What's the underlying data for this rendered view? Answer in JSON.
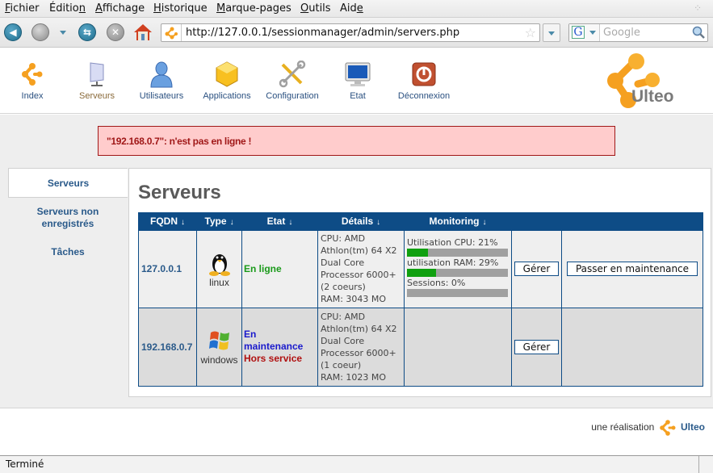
{
  "browser": {
    "menu": [
      {
        "label": "Fichier",
        "ul": 0
      },
      {
        "label": "Édition",
        "ul": 6
      },
      {
        "label": "Affichage",
        "ul": 0
      },
      {
        "label": "Historique",
        "ul": 0
      },
      {
        "label": "Marque-pages",
        "ul": 0
      },
      {
        "label": "Outils",
        "ul": 0
      },
      {
        "label": "Aide",
        "ul": 3
      }
    ],
    "url": "http://127.0.0.1/sessionmanager/admin/servers.php",
    "search_placeholder": "Google",
    "search_engine_letter": "G",
    "status": "Terminé"
  },
  "topnav": {
    "items": [
      {
        "label": "Index",
        "icon": "ulteo-logo-icon"
      },
      {
        "label": "Serveurs",
        "icon": "server-icon",
        "active": true
      },
      {
        "label": "Utilisateurs",
        "icon": "user-icon"
      },
      {
        "label": "Applications",
        "icon": "applications-icon"
      },
      {
        "label": "Configuration",
        "icon": "tools-icon"
      },
      {
        "label": "Etat",
        "icon": "monitor-icon"
      },
      {
        "label": "Déconnexion",
        "icon": "power-icon"
      }
    ],
    "logo_text": "Ulteo"
  },
  "alert": "\"192.168.0.7\": n'est pas en ligne !",
  "sidebar": {
    "items": [
      {
        "label": "Serveurs",
        "active": true
      },
      {
        "label": "Serveurs non enregistrés"
      },
      {
        "label": "Tâches"
      }
    ]
  },
  "main": {
    "title": "Serveurs",
    "columns": [
      "FQDN",
      "Type",
      "Etat",
      "Détails",
      "Monitoring"
    ],
    "sort_arrow": "↓",
    "rows": [
      {
        "fqdn": "127.0.0.1",
        "type": "linux",
        "states": [
          {
            "text": "En ligne",
            "color": "#1a9a1a"
          }
        ],
        "details": [
          "CPU: AMD",
          "Athlon(tm) 64 X2",
          "Dual Core",
          "Processor 6000+",
          "(2 coeurs)",
          "RAM: 3043 MO"
        ],
        "monitoring": [
          {
            "label": "Utilisation CPU: 21%",
            "value": 21
          },
          {
            "label": "utilisation RAM: 29%",
            "value": 29
          },
          {
            "label": "Sessions: 0%",
            "value": 0
          }
        ],
        "manage_label": "Gérer",
        "maintenance_label": "Passer en maintenance"
      },
      {
        "fqdn": "192.168.0.7",
        "type": "windows",
        "states": [
          {
            "text": "En maintenance",
            "color": "#1a1acc"
          },
          {
            "text": "Hors service",
            "color": "#b01010"
          }
        ],
        "details": [
          "CPU: AMD",
          "Athlon(tm) 64 X2",
          "Dual Core",
          "Processor 6000+",
          "(1 coeur)",
          "RAM: 1023 MO"
        ],
        "monitoring": [],
        "manage_label": "Gérer",
        "maintenance_label": ""
      }
    ]
  },
  "footer": {
    "credit_prefix": "une réalisation",
    "credit_brand": "Ulteo"
  },
  "colors": {
    "header_blue": "#0e4c86",
    "accent_orange": "#f5a020",
    "alert_bg": "#ffcccc",
    "alert_text": "#a01818",
    "bar_fill": "#10a010",
    "bar_bg": "#a0a0a0"
  }
}
